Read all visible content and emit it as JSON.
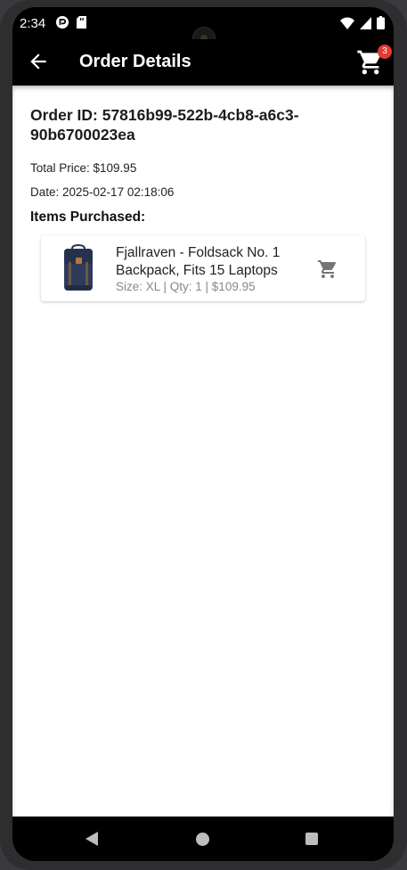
{
  "status_bar": {
    "time": "2:34",
    "left_icons": [
      "pocket-casts-icon",
      "sd-card-icon"
    ],
    "right_icons": [
      "wifi-icon",
      "signal-icon",
      "battery-icon"
    ]
  },
  "app_bar": {
    "title": "Order Details",
    "cart_badge": "3"
  },
  "order": {
    "id_label": "Order ID: 57816b99-522b-4cb8-a6c3-90b6700023ea",
    "total_price": "Total Price: $109.95",
    "date": "Date: 2025-02-17 02:18:06",
    "items_heading": "Items Purchased:"
  },
  "items": [
    {
      "name": "Fjallraven - Foldsack No. 1 Backpack, Fits 15 Laptops",
      "meta": "Size: XL | Qty: 1 | $109.95",
      "image": "backpack-image",
      "icon": "shopping-cart-icon"
    }
  ],
  "colors": {
    "app_bar": "#000000",
    "badge": "#e53935",
    "meta_text": "#888888",
    "item_cart_icon": "#757575"
  }
}
